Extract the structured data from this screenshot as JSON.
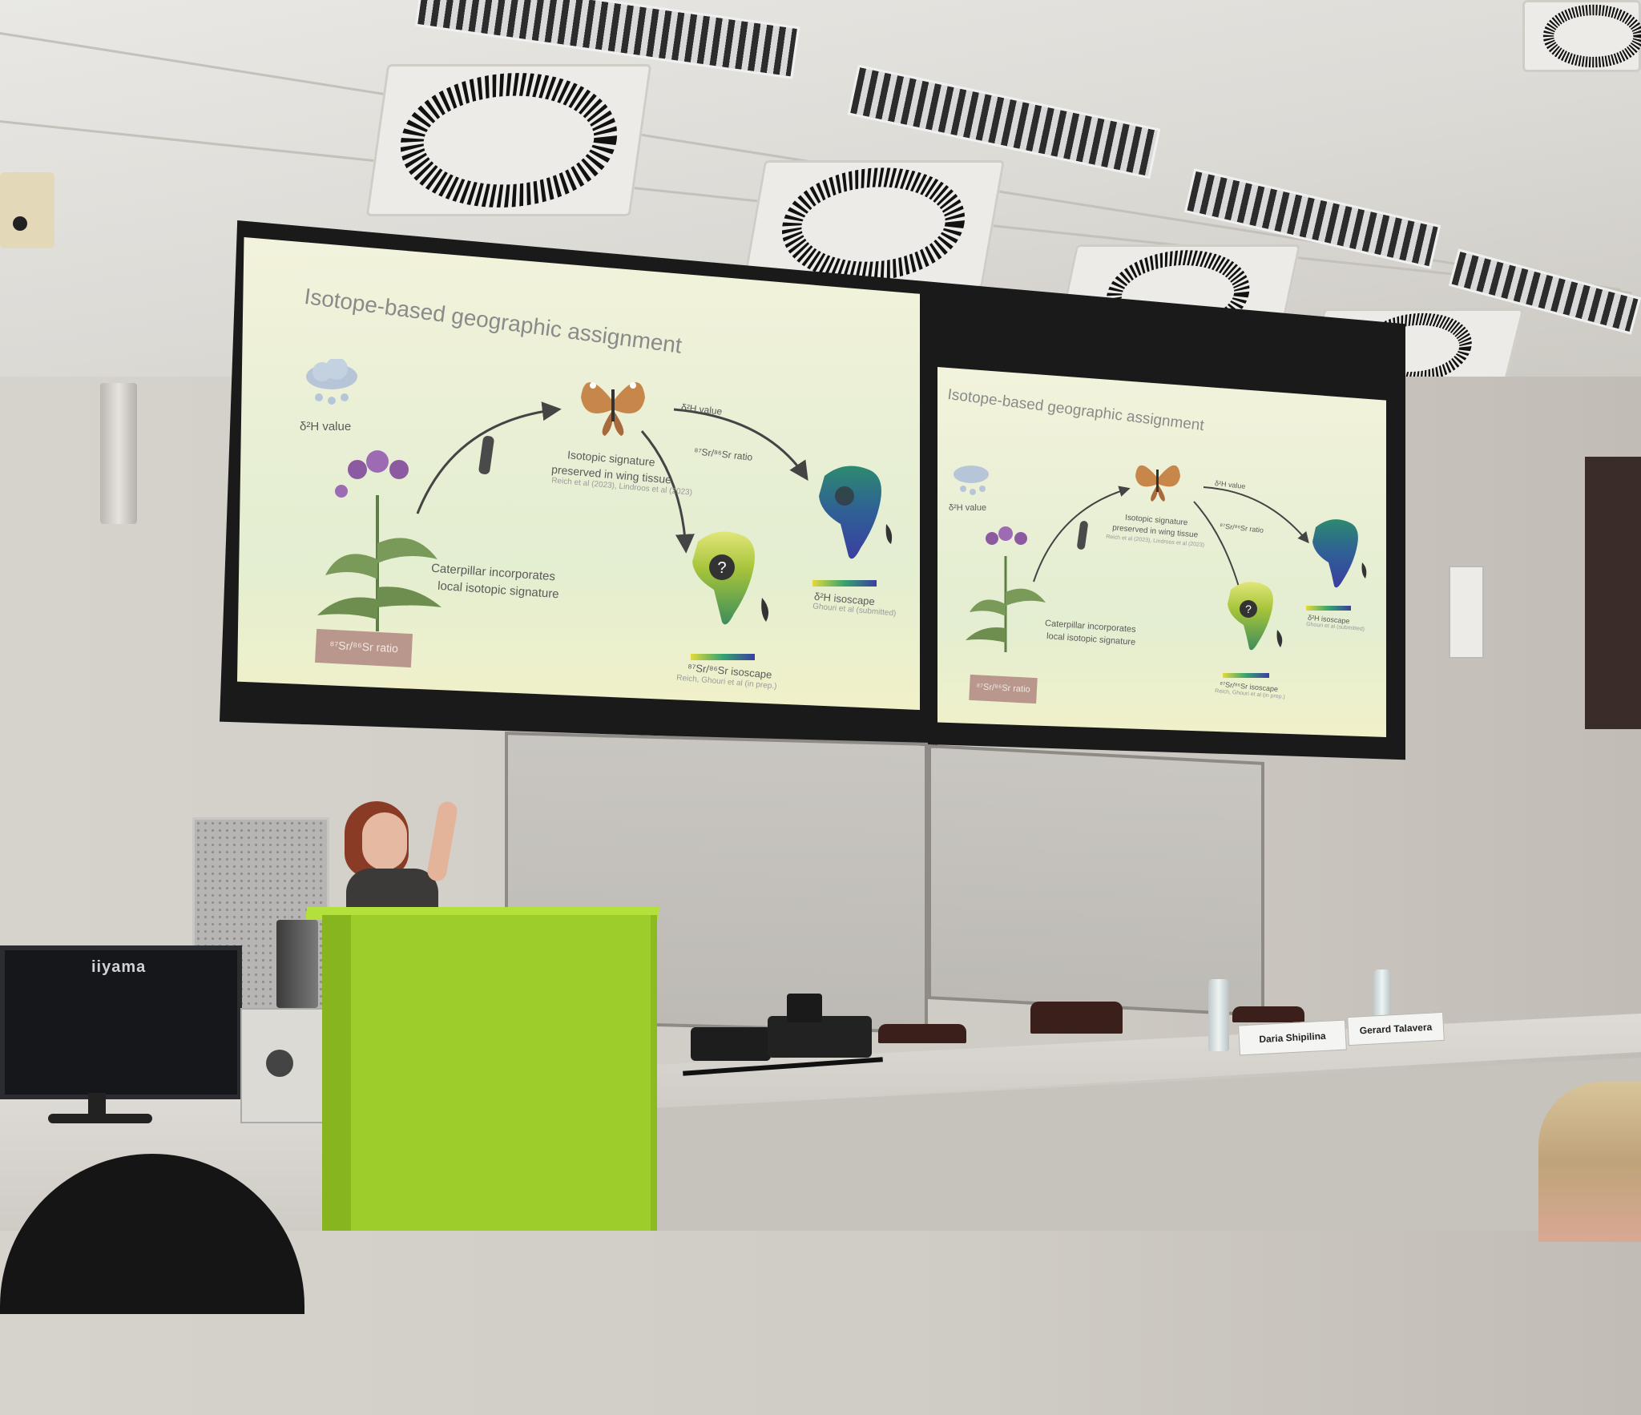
{
  "slides": [
    {
      "title": "Isotope-based geographic assignment",
      "rain_label": "δ²H value",
      "butterfly_caption_1": "Isotopic signature",
      "butterfly_caption_2": "preserved in wing tissue",
      "butterfly_ref": "Reich et al (2023), Lindroos et al (2023)",
      "arrow_label_h": "δ²H value",
      "arrow_label_sr": "⁸⁷Sr/⁸⁶Sr ratio",
      "caterpillar_1": "Caterpillar incorporates",
      "caterpillar_2": "local isotopic signature",
      "soil_label": "⁸⁷Sr/⁸⁶Sr ratio",
      "isoscape_h": "δ²H isoscape",
      "isoscape_h_ref": "Ghouri et al (submitted)",
      "isoscape_sr": "⁸⁷Sr/⁸⁶Sr isoscape",
      "isoscape_sr_ref": "Reich, Ghouri et al (in prep.)",
      "question_mark": "?"
    }
  ],
  "monitor": {
    "brand": "iiyama"
  },
  "name_cards": [
    "Daria Shipilina",
    "Gerard Talavera"
  ],
  "colors": {
    "podium": "#9ccd2b",
    "slide_bg": "#eef0d6",
    "soil": "#b9978c",
    "africa_h_top": "#2d8a70",
    "africa_h_bottom": "#3a3fa0",
    "africa_sr": "#a7c43a"
  }
}
